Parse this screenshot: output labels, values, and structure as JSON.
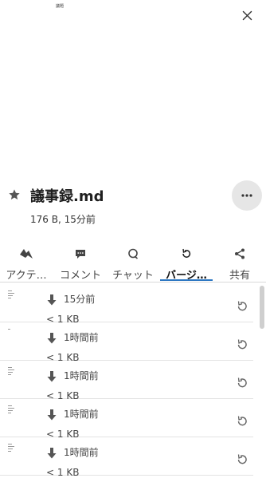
{
  "preview": {
    "tiny_title": "議題"
  },
  "file": {
    "name": "議事録.md",
    "meta": "176 B, 15分前"
  },
  "tabs": [
    {
      "label": "アクテ…",
      "icon": "activity-icon"
    },
    {
      "label": "コメント",
      "icon": "comment-icon"
    },
    {
      "label": "チャット",
      "icon": "chat-icon"
    },
    {
      "label": "バージ…",
      "icon": "history-icon",
      "active": true
    },
    {
      "label": "共有",
      "icon": "share-icon"
    }
  ],
  "versions": [
    {
      "time": "15分前",
      "size": "< 1 KB"
    },
    {
      "time": "1時間前",
      "size": "< 1 KB"
    },
    {
      "time": "1時間前",
      "size": "< 1 KB"
    },
    {
      "time": "1時間前",
      "size": "< 1 KB"
    },
    {
      "time": "1時間前",
      "size": "< 1 KB"
    }
  ],
  "colors": {
    "accent": "#2d77c2",
    "more_bg": "#e6e6e6"
  }
}
